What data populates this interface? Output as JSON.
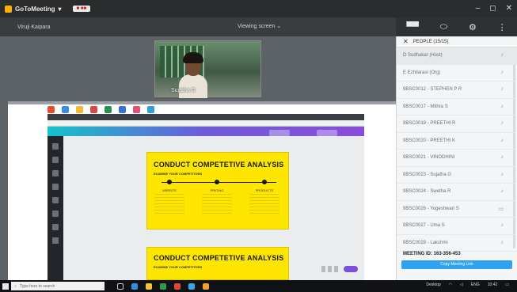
{
  "titlebar": {
    "app_name": "GoToMeeting",
    "pill": "■ ■■",
    "controls": [
      "–",
      "◻",
      "✕"
    ]
  },
  "meeting_strip": {
    "left": "Viruji Kaipara",
    "center": "Viewing screen"
  },
  "right_tools": {
    "icons": [
      "screen-share-icon",
      "chat-icon",
      "settings-icon",
      "more-icon"
    ]
  },
  "webcam": {
    "label": "Sujatha G"
  },
  "shared_screen": {
    "canva_bar_text": "",
    "cards": [
      {
        "title": "CONDUCT COMPETETIVE ANALYSIS",
        "subtitle": "Examine your competitors",
        "columns": [
          {
            "label": "WEBSITE"
          },
          {
            "label": "PRICING"
          },
          {
            "label": "PRODUCTS"
          }
        ]
      },
      {
        "title": "CONDUCT COMPETETIVE ANALYSIS",
        "subtitle": "Examine your competitors"
      }
    ]
  },
  "panel": {
    "title": "PEOPLE (15/15)",
    "participants": [
      {
        "name": "D Sudhakar (Host)",
        "icon": "mic-icon"
      },
      {
        "name": "E Ezhilarasi (Org)",
        "icon": "mic-icon"
      },
      {
        "name": "9BSC0012 - STEPHEN P R",
        "icon": "mic-icon"
      },
      {
        "name": "9BSC0017 - Mithra S",
        "icon": "mic-icon"
      },
      {
        "name": "9BSC0019 - PREETHI R",
        "icon": "mic-icon"
      },
      {
        "name": "9BSC0020 - PREETHI K",
        "icon": "mic-icon"
      },
      {
        "name": "9BSC0021 - VINODHINI",
        "icon": "mic-icon"
      },
      {
        "name": "9BSC0023 - Sujatha G",
        "icon": "mic-icon"
      },
      {
        "name": "9BSC0024 - Swetha R",
        "icon": "mic-icon"
      },
      {
        "name": "9BSC0026 - Yogeshwari S",
        "icon": "video-icon"
      },
      {
        "name": "9BSC0027 - Uma S",
        "icon": "mic-icon"
      },
      {
        "name": "9BSC0028 - Lakshmi",
        "icon": "mic-icon"
      }
    ],
    "meeting_id": "MEETING ID: 163-356-453",
    "copy_button": "Copy Meeting Link"
  },
  "taskbar": {
    "search_placeholder": "Type here to search",
    "tray_text": "Desktop",
    "lang": "ENG",
    "time": "10:42"
  }
}
